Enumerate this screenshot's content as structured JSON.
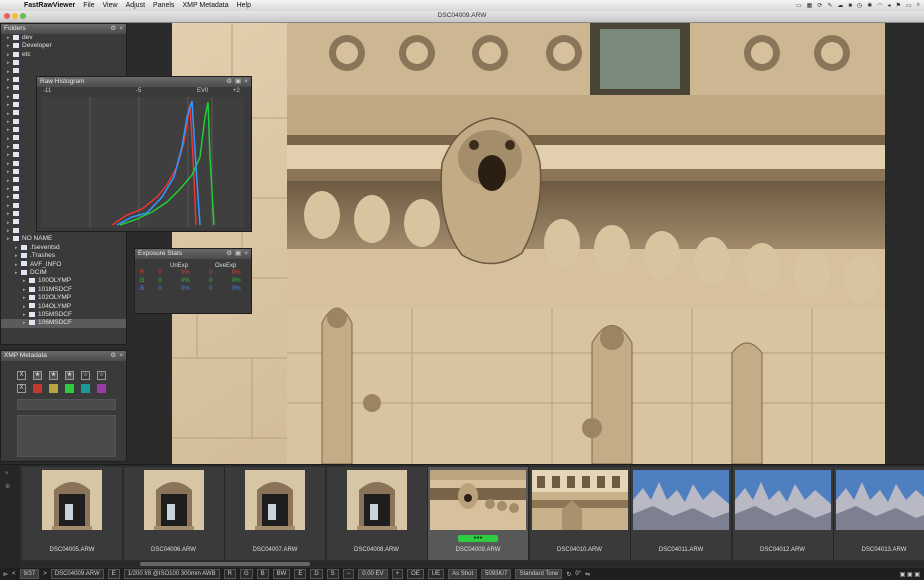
{
  "menubar": {
    "apple_icon": "apple-logo-icon",
    "app_name": "FastRawViewer",
    "items": [
      "File",
      "View",
      "Adjust",
      "Panels",
      "XMP Metadata",
      "Help"
    ]
  },
  "window": {
    "title": "DSC04009.ARW"
  },
  "folders_panel": {
    "title": "Folders",
    "items": [
      {
        "label": "dev",
        "indent": 1
      },
      {
        "label": "Developer",
        "indent": 1
      },
      {
        "label": "etc",
        "indent": 1
      },
      {
        "label": "",
        "indent": 1
      },
      {
        "label": "",
        "indent": 1
      },
      {
        "label": "",
        "indent": 1
      },
      {
        "label": "",
        "indent": 1
      },
      {
        "label": "",
        "indent": 1
      },
      {
        "label": "",
        "indent": 1
      },
      {
        "label": "",
        "indent": 1
      },
      {
        "label": "",
        "indent": 1
      },
      {
        "label": "",
        "indent": 1
      },
      {
        "label": "",
        "indent": 1
      },
      {
        "label": "",
        "indent": 1
      },
      {
        "label": "",
        "indent": 1
      },
      {
        "label": "",
        "indent": 1
      },
      {
        "label": "",
        "indent": 1
      },
      {
        "label": "",
        "indent": 1
      },
      {
        "label": "",
        "indent": 1
      },
      {
        "label": "",
        "indent": 1
      },
      {
        "label": "",
        "indent": 1
      },
      {
        "label": "",
        "indent": 1
      },
      {
        "label": "",
        "indent": 1
      },
      {
        "label": "",
        "indent": 1
      },
      {
        "label": "NO NAME",
        "indent": 1
      },
      {
        "label": ".fseventsd",
        "indent": 2
      },
      {
        "label": ".Trashes",
        "indent": 2
      },
      {
        "label": "AVF_INFO",
        "indent": 2
      },
      {
        "label": "DCIM",
        "indent": 2
      },
      {
        "label": "100OLYMP",
        "indent": 3
      },
      {
        "label": "101MSDCF",
        "indent": 3
      },
      {
        "label": "102OLYMP",
        "indent": 3
      },
      {
        "label": "104OLYMP",
        "indent": 3
      },
      {
        "label": "105MSDCF",
        "indent": 3
      },
      {
        "label": "106MSDCF",
        "indent": 3,
        "selected": true
      }
    ]
  },
  "histogram_panel": {
    "title": "Raw Histogram",
    "scale_labels": [
      "-11",
      "-5",
      "EV0",
      "+2"
    ]
  },
  "exposure_panel": {
    "title": "Exposure Stats",
    "col_unexp": "UnExp",
    "col_ovexp": "OveExp",
    "rows": [
      {
        "ch": "R",
        "color": "#e03a3a",
        "u1": "0",
        "u2": "0%",
        "o1": "0",
        "o2": "0%"
      },
      {
        "ch": "G",
        "color": "#30c040",
        "u1": "0",
        "u2": "0%",
        "o1": "0",
        "o2": "0%"
      },
      {
        "ch": "B",
        "color": "#4b7cf0",
        "u1": "0",
        "u2": "0%",
        "o1": "0",
        "o2": "0%"
      }
    ]
  },
  "xmp_panel": {
    "title": "XMP Metadata",
    "reject_label": "X",
    "star_icon": "star-icon",
    "label_colors": [
      "#c0392b",
      "#b5a642",
      "#2ecc40",
      "#1a9a9a",
      "#9b3aa6"
    ]
  },
  "filmstrip": {
    "thumbs": [
      {
        "name": "DSC04005.ARW",
        "kind": "window"
      },
      {
        "name": "DSC04006.ARW",
        "kind": "window"
      },
      {
        "name": "DSC04007.ARW",
        "kind": "window"
      },
      {
        "name": "DSC04008.ARW",
        "kind": "window"
      },
      {
        "name": "DSC04009.ARW",
        "kind": "gargoyle",
        "selected": true
      },
      {
        "name": "DSC04010.ARW",
        "kind": "stone"
      },
      {
        "name": "DSC04011.ARW",
        "kind": "sky"
      },
      {
        "name": "DSC04012.ARW",
        "kind": "sky"
      },
      {
        "name": "DSC04013.ARW",
        "kind": "sky"
      }
    ]
  },
  "statusbar": {
    "counter": "9/37",
    "filename": "DSC04009.ARW",
    "exif": "1/200 f/8 @ISO100 300mm AWB",
    "channels": [
      "R",
      "G",
      "B",
      "BW"
    ],
    "flags": [
      "E",
      "D",
      "S"
    ],
    "exposure": "0.00 EV",
    "oe": "OE",
    "ue": "UE",
    "wb": "As Shot",
    "wb_value": "5093K/7",
    "tone": "Standard Tone",
    "rotation": "0°"
  },
  "colors": {
    "accent": "#4a90e2",
    "panel_bg": "#3a3a3a",
    "selected_badge": "#2ecc40"
  }
}
